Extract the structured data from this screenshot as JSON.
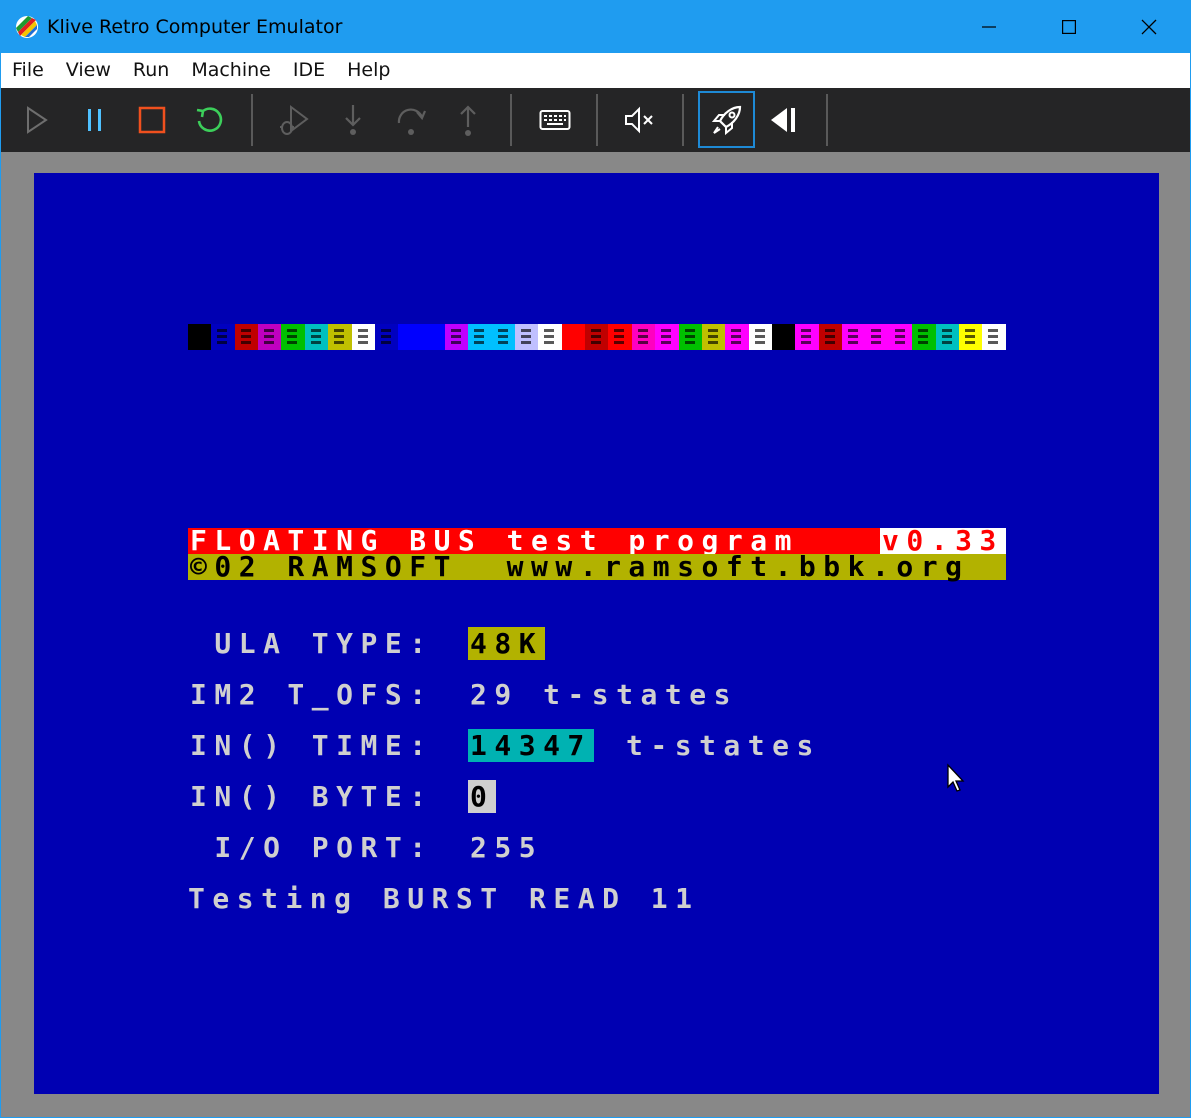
{
  "window": {
    "title": "Klive Retro Computer Emulator"
  },
  "menu": {
    "items": [
      "File",
      "View",
      "Run",
      "Machine",
      "IDE",
      "Help"
    ]
  },
  "toolbar": {
    "buttons": [
      {
        "name": "play-icon",
        "color": "#6e6e6e"
      },
      {
        "name": "pause-icon",
        "color": "#4fc1ff"
      },
      {
        "name": "stop-icon",
        "color": "#f0501e"
      },
      {
        "name": "restart-icon",
        "color": "#3ccf5a"
      },
      {
        "name": "debug-icon",
        "color": "#5e5e5e"
      },
      {
        "name": "step-into-icon",
        "color": "#5e5e5e"
      },
      {
        "name": "step-over-icon",
        "color": "#5e5e5e"
      },
      {
        "name": "step-out-icon",
        "color": "#5e5e5e"
      },
      {
        "name": "keyboard-icon",
        "color": "#ffffff"
      },
      {
        "name": "mute-icon",
        "color": "#ffffff"
      },
      {
        "name": "rocket-icon",
        "color": "#ffffff"
      },
      {
        "name": "tape-rewind-icon",
        "color": "#ffffff"
      }
    ]
  },
  "screen": {
    "border_color": "#0000b2",
    "colorbar": [
      "#000000",
      "#0000c0",
      "#c00000",
      "#c000c0",
      "#00c000",
      "#00c0c0",
      "#c0c000",
      "#ffffff",
      "#0000c0",
      "#0000ff",
      "#0000ff",
      "#c000ff",
      "#00c0ff",
      "#00c0ff",
      "#c0c0ff",
      "#ffffff",
      "#ff0000",
      "#c00000",
      "#ff0000",
      "#ff00c0",
      "#ff00ff",
      "#00c000",
      "#c0c000",
      "#ff00ff",
      "#ffffff",
      "#000000",
      "#ff00ff",
      "#c00000",
      "#ff00ff",
      "#ff00ff",
      "#ff00ff",
      "#00c000",
      "#00c0c0",
      "#ffff00",
      "#ffffff"
    ],
    "banner_title": "FLOATING BUS test program",
    "banner_version": "v0.33",
    "banner_copyright": "©02 RAMSOFT  www.ramsoft.bbk.org",
    "lines": {
      "ula_label": " ULA TYPE:",
      "ula_value": "48K",
      "im2_label": "IM2 T_OFS:",
      "im2_value": "29 t-states",
      "in_time_label": "IN() TIME:",
      "in_time_value": "14347",
      "in_time_unit": "t-states",
      "in_byte_label": "IN() BYTE:",
      "in_byte_value": "0",
      "io_port_label": " I/O PORT:",
      "io_port_value": "255",
      "status": "Testing BURST READ 11"
    }
  }
}
